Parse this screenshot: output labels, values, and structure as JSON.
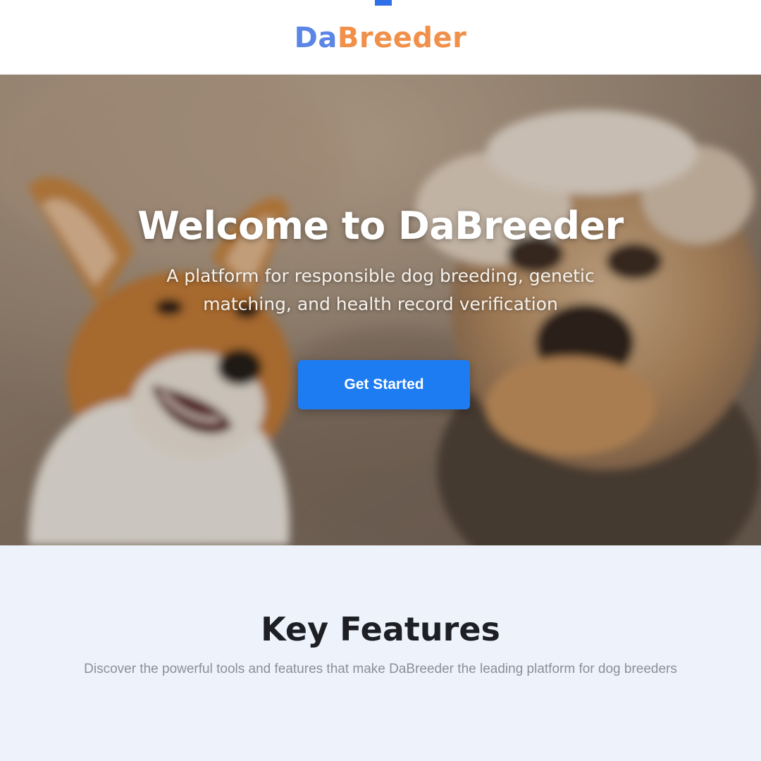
{
  "header": {
    "logo_part_1": "Da",
    "logo_part_2": "Breeder",
    "colors": {
      "logo_part_1": "#5b86e5",
      "logo_part_2": "#f0904a"
    }
  },
  "hero": {
    "title": "Welcome to DaBreeder",
    "subtitle": "A platform for responsible dog breeding, genetic matching, and health record verification",
    "cta_label": "Get Started",
    "colors": {
      "cta": "#1e7cf2"
    }
  },
  "features": {
    "title": "Key Features",
    "description": "Discover the powerful tools and features that make DaBreeder the leading platform for dog breeders"
  }
}
